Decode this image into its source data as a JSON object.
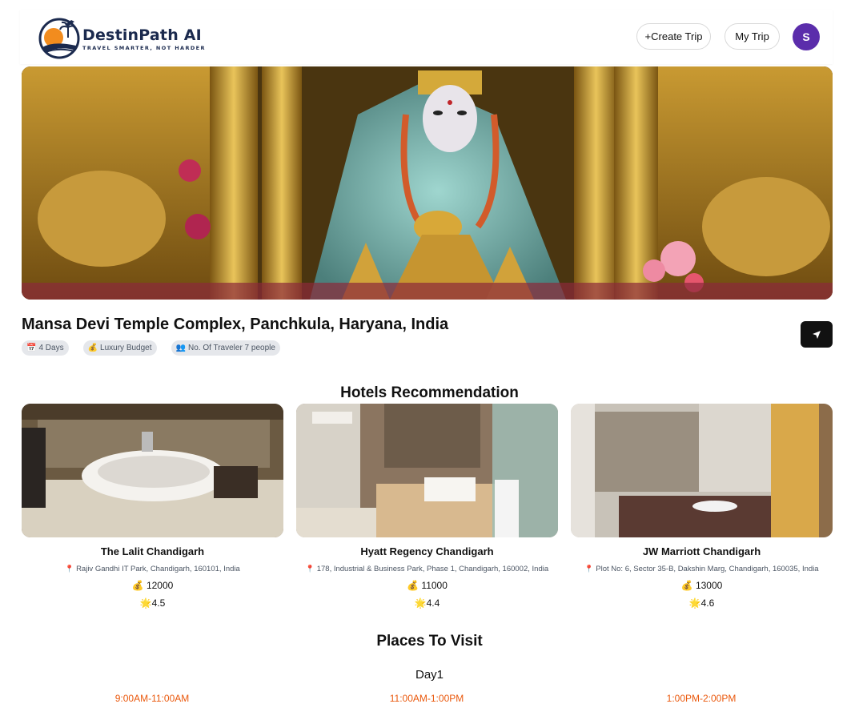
{
  "header": {
    "brand_name": "DestinPath AI",
    "brand_tagline": "TRAVEL SMARTER, NOT HARDER",
    "create_trip_label": "+Create Trip",
    "my_trip_label": "My Trip",
    "avatar_initial": "S"
  },
  "trip": {
    "title": "Mansa Devi Temple Complex, Panchkula, Haryana, India",
    "chips": [
      {
        "icon": "calendar-icon",
        "emoji": "📅",
        "label": "4 Days"
      },
      {
        "icon": "money-bag-icon",
        "emoji": "💰",
        "label": "Luxury Budget"
      },
      {
        "icon": "people-icon",
        "emoji": "👥",
        "label": "No. Of Traveler 7 people"
      }
    ]
  },
  "hotels_section": {
    "title": "Hotels Recommendation",
    "hotels": [
      {
        "name": "The Lalit Chandigarh",
        "address": "Rajiv Gandhi IT Park, Chandigarh, 160101, India",
        "price": "12000",
        "rating": "4.5"
      },
      {
        "name": "Hyatt Regency Chandigarh",
        "address": "178, Industrial & Business Park, Phase 1, Chandigarh, 160002, India",
        "price": "11000",
        "rating": "4.4"
      },
      {
        "name": "JW Marriott Chandigarh",
        "address": "Plot No: 6, Sector 35-B, Dakshin Marg, Chandigarh, 160035, India",
        "price": "13000",
        "rating": "4.6"
      }
    ]
  },
  "places_section": {
    "title": "Places To Visit",
    "day_label": "Day1",
    "time_slots": [
      "9:00AM-11:00AM",
      "11:00AM-1:00PM",
      "1:00PM-2:00PM"
    ]
  },
  "icons": {
    "pin": "📍",
    "price": "💰",
    "rating": "🌟"
  },
  "colors": {
    "accent_orange": "#ea580c",
    "avatar_purple": "#5b2dab",
    "pin_pink": "#e11d78"
  }
}
